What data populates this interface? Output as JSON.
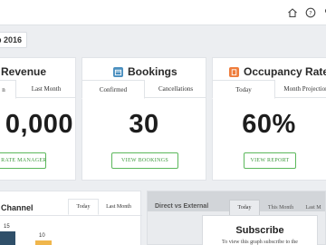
{
  "header": {
    "icons": [
      "home-icon",
      "help-icon",
      "user-icon"
    ]
  },
  "date_filter": {
    "label": "p 2016"
  },
  "cards": {
    "revenue": {
      "title": "Revenue",
      "tabs": [
        "n",
        "Last Month"
      ],
      "value": "0,000",
      "button": "& RATE MANAGER"
    },
    "bookings": {
      "title": "Bookings",
      "icon": "calendar-icon",
      "icon_color": "#4a8fbf",
      "tabs": [
        "Confirmed",
        "Cancellations"
      ],
      "value": "30",
      "button": "VIEW BOOKINGS"
    },
    "occupancy": {
      "title": "Occupancy Rate",
      "icon": "building-icon",
      "icon_color": "#ef7d3c",
      "tabs": [
        "Today",
        "Month Projection"
      ],
      "value": "60%",
      "button": "VIEW REPORT"
    }
  },
  "channel_panel": {
    "title": "Channel",
    "tabs": [
      "Today",
      "Last Month"
    ],
    "bar_labels": [
      "15",
      "10"
    ],
    "bar_colors": [
      "#2f4f69",
      "#f0b64c"
    ]
  },
  "direct_panel": {
    "title": "Direct vs External",
    "tabs": [
      "Today",
      "This Month",
      "Last M"
    ],
    "subscribe_title": "Subscribe",
    "subscribe_text": "To view this graph subscribe to the"
  },
  "colors": {
    "accent_green": "#5cb85c",
    "background": "#eceef1"
  }
}
